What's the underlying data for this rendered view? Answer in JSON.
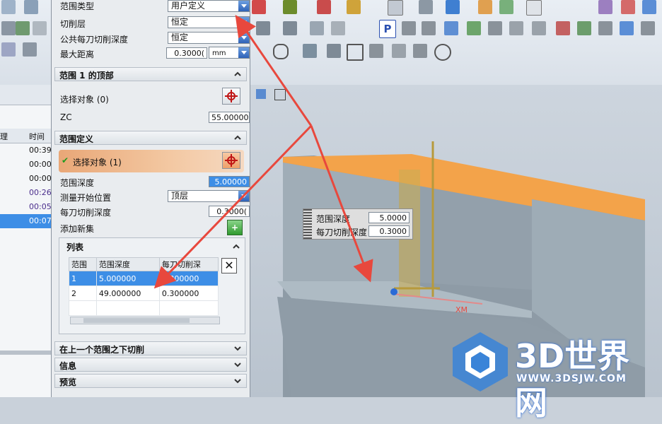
{
  "dialog": {
    "range_type_label": "范围类型",
    "range_type_value": "用户定义",
    "cut_level_label": "切削层",
    "cut_level_value": "恒定",
    "common_depth_label": "公共每刀切削深度",
    "common_depth_value": "恒定",
    "max_distance_label": "最大距离",
    "max_distance_value": "0.3000(",
    "max_distance_unit": "mm",
    "section_top": "范围 1 的顶部",
    "select_object_label": "选择对象 (0)",
    "zc_label": "ZC",
    "zc_value": "55.00000",
    "section_range_def": "范围定义",
    "select_object_selected": "选择对象 (1)",
    "range_depth_label": "范围深度",
    "range_depth_value": "5.00000",
    "measure_start_label": "测量开始位置",
    "measure_start_value": "顶层",
    "per_cut_depth_label": "每刀切削深度",
    "per_cut_depth_value": "0.3000(",
    "add_new_set_label": "添加新集",
    "list_title": "列表",
    "list_columns": [
      "范围",
      "范围深度",
      "每刀切削深"
    ],
    "list_rows": [
      {
        "range": "1",
        "depth": "5.000000",
        "cut": "0.300000"
      },
      {
        "range": "2",
        "depth": "49.000000",
        "cut": "0.300000"
      }
    ],
    "section_below": "在上一个范围之下切削",
    "section_info": "信息",
    "section_preview": "预览"
  },
  "left_panel": {
    "col_a": "理",
    "col_b": "时间",
    "times": [
      "00:39",
      "00:00",
      "00:00",
      "00:26",
      "00:05",
      "00:07"
    ]
  },
  "viewport": {
    "dim_depth_label": "范围深度",
    "dim_depth_value": "5.0000",
    "dim_cut_label": "每刀切削深度",
    "dim_cut_value": "0.3000",
    "axis_label": "XM"
  },
  "watermark": {
    "text": "3D世界网",
    "url": "WWW.3DSJW.COM"
  },
  "colors": {
    "accent_blue": "#2f63b8",
    "select_red": "#c01515",
    "orange_top": "#f6a54a",
    "arrow_red": "#e8483d"
  }
}
